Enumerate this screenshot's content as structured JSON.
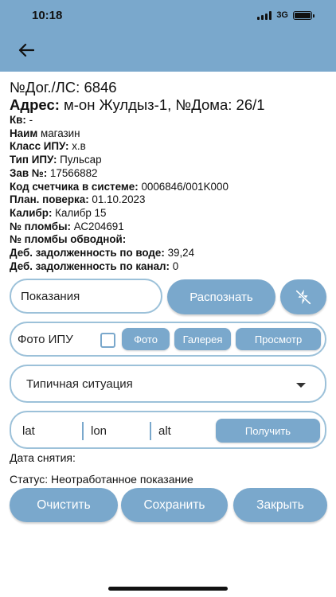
{
  "statusbar": {
    "time": "10:18",
    "network": "3G"
  },
  "appbar": {
    "back_icon": "arrow-left-icon"
  },
  "info": {
    "contract": {
      "label": "№Дог./ЛС:",
      "value": "6846"
    },
    "address": {
      "label": "Адрес:",
      "value": "м-он Жулдыз-1, №Дома: 26/1"
    },
    "fields": [
      {
        "label": "Кв:",
        "value": "-"
      },
      {
        "label": "Наим",
        "value": "магазин"
      },
      {
        "label": "Класс ИПУ:",
        "value": "х.в"
      },
      {
        "label": "Тип ИПУ:",
        "value": "Пульсар"
      },
      {
        "label": "Зав №:",
        "value": "17566882"
      },
      {
        "label": "Код счетчика в системе:",
        "value": "0006846/001K000"
      },
      {
        "label": "План. поверка:",
        "value": "01.10.2023"
      },
      {
        "label": "Калибр:",
        "value": "Калибр 15"
      },
      {
        "label": "№ пломбы:",
        "value": "АС204691"
      },
      {
        "label": "№ пломбы обводной:",
        "value": ""
      },
      {
        "label": "Деб. задолженность по воде:",
        "value": "39,24"
      },
      {
        "label": "Деб. задолженность по канал:",
        "value": "0"
      }
    ]
  },
  "readings": {
    "value": "Показания",
    "recognize_label": "Распознать",
    "flash_icon": "flash-off-icon"
  },
  "photo": {
    "label": "Фото ИПУ",
    "photo_btn": "Фото",
    "gallery_btn": "Галерея",
    "view_btn": "Просмотр"
  },
  "situation": {
    "selected": "Типичная ситуация",
    "dropdown_icon": "caret-down-icon"
  },
  "coords": {
    "lat": "lat",
    "lon": "lon",
    "alt": "alt",
    "get_btn": "Получить"
  },
  "date_label": "Дата снятия:",
  "status_text": "Статус: Неотработанное показание",
  "actions": {
    "clear": "Очистить",
    "save": "Сохранить",
    "close": "Закрыть"
  },
  "colors": {
    "primary": "#7aa8cc",
    "border": "#9cc1d9",
    "text": "#111111",
    "background": "#ffffff"
  }
}
